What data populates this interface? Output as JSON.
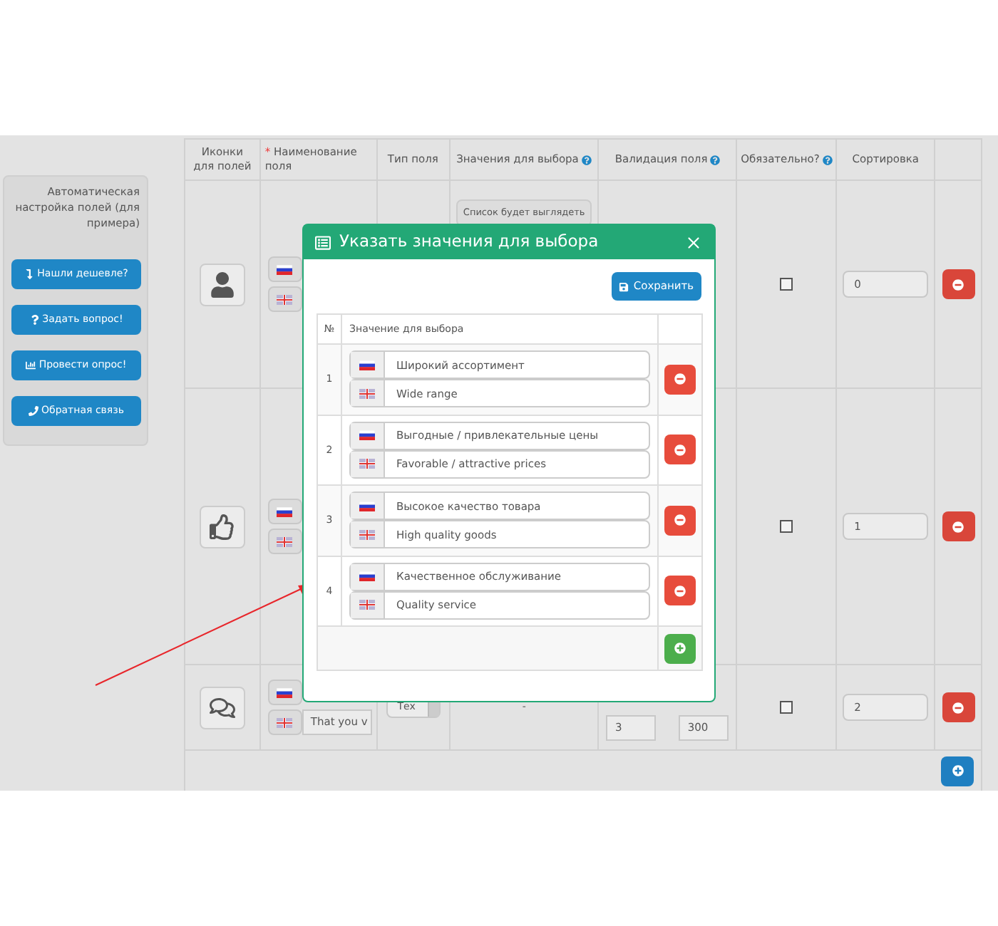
{
  "sidebar": {
    "title": "Автоматическая настройка полей (для примера)",
    "buttons": [
      {
        "kind": "cheaper",
        "label": "Нашли дешевле?"
      },
      {
        "kind": "question",
        "label": "Задать вопрос!"
      },
      {
        "kind": "poll",
        "label": "Провести опрос!"
      },
      {
        "kind": "callback",
        "label": "Обратная связь"
      }
    ]
  },
  "table": {
    "columns": [
      {
        "label": "Иконки для полей"
      },
      {
        "label": "Наименование поля",
        "mark": "*"
      },
      {
        "label": "Тип поля"
      },
      {
        "label": "Значения для выбора",
        "help": true
      },
      {
        "label": "Валидация поля",
        "help": true
      },
      {
        "label": "Обязательно?",
        "help": true
      },
      {
        "label": "Сортировка"
      }
    ],
    "rows": [
      {
        "kind": "user",
        "values_button": "Список будет выглядеть",
        "required": false,
        "sort": "0"
      },
      {
        "kind": "thumbs-up",
        "required": false,
        "sort": "1"
      },
      {
        "kind": "comments",
        "name_en": "That you v",
        "type": "Тех",
        "values": "-",
        "validation_min": "3",
        "validation_max": "300",
        "required": false,
        "sort": "2"
      }
    ]
  },
  "modal": {
    "title": "Указать значения для выбора",
    "save": "Сохранить",
    "columns": [
      "№",
      "Значение для выбора"
    ],
    "items": [
      {
        "number": "1",
        "ru": "Широкий ассортимент",
        "en": "Wide range"
      },
      {
        "number": "2",
        "ru": "Выгодные / привлекательные цены",
        "en": "Favorable / attractive prices"
      },
      {
        "number": "3",
        "ru": "Высокое качество товара",
        "en": "High quality goods"
      },
      {
        "number": "4",
        "ru": "Качественное обслуживание",
        "en": "Quality service"
      }
    ]
  }
}
